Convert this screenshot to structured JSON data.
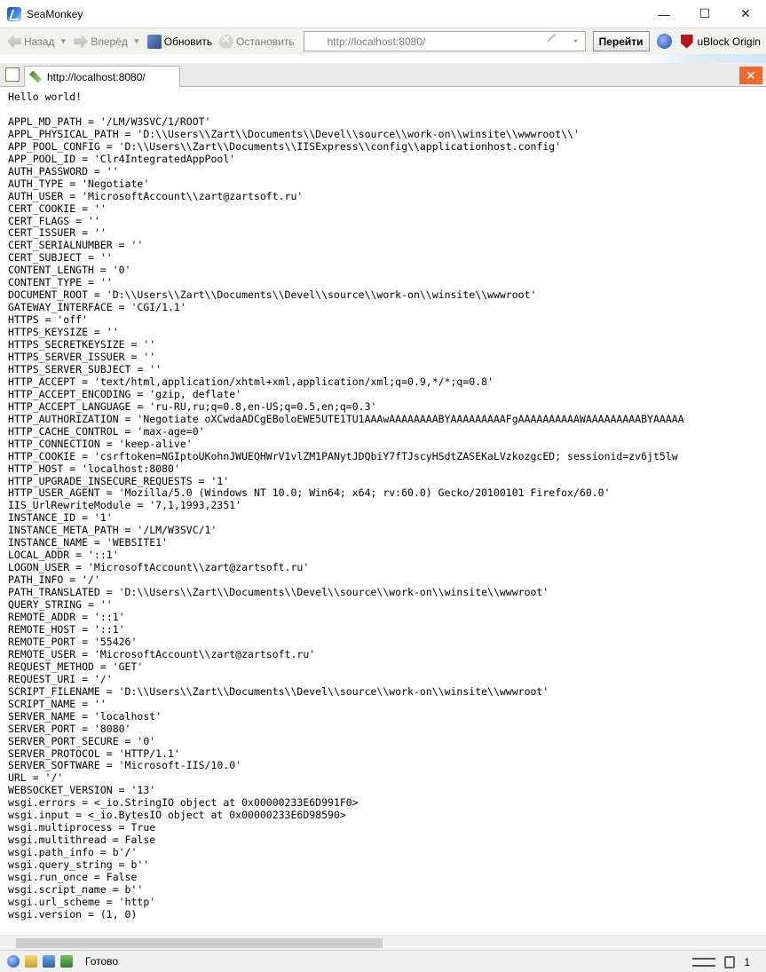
{
  "window": {
    "title": "SeaMonkey",
    "controls": {
      "minimize": "—",
      "maximize": "☐",
      "close": "✕"
    }
  },
  "toolbar": {
    "back_label": "Назад",
    "forward_label": "Вперёд",
    "reload_label": "Обновить",
    "stop_label": "Остановить",
    "url_value": "http://localhost:8080/",
    "go_label": "Перейти",
    "ublock_label": "uBlock Origin"
  },
  "tabs": [
    {
      "label": "http://localhost:8080/"
    }
  ],
  "page": {
    "greeting": "Hello world!",
    "lines": [
      "APPL_MD_PATH = '/LM/W3SVC/1/ROOT'",
      "APPL_PHYSICAL_PATH = 'D:\\\\Users\\\\Zart\\\\Documents\\\\Devel\\\\source\\\\work-on\\\\winsite\\\\wwwroot\\\\'",
      "APP_POOL_CONFIG = 'D:\\\\Users\\\\Zart\\\\Documents\\\\IISExpress\\\\config\\\\applicationhost.config'",
      "APP_POOL_ID = 'Clr4IntegratedAppPool'",
      "AUTH_PASSWORD = ''",
      "AUTH_TYPE = 'Negotiate'",
      "AUTH_USER = 'MicrosoftAccount\\\\zart@zartsoft.ru'",
      "CERT_COOKIE = ''",
      "CERT_FLAGS = ''",
      "CERT_ISSUER = ''",
      "CERT_SERIALNUMBER = ''",
      "CERT_SUBJECT = ''",
      "CONTENT_LENGTH = '0'",
      "CONTENT_TYPE = ''",
      "DOCUMENT_ROOT = 'D:\\\\Users\\\\Zart\\\\Documents\\\\Devel\\\\source\\\\work-on\\\\winsite\\\\wwwroot'",
      "GATEWAY_INTERFACE = 'CGI/1.1'",
      "HTTPS = 'off'",
      "HTTPS_KEYSIZE = ''",
      "HTTPS_SECRETKEYSIZE = ''",
      "HTTPS_SERVER_ISSUER = ''",
      "HTTPS_SERVER_SUBJECT = ''",
      "HTTP_ACCEPT = 'text/html,application/xhtml+xml,application/xml;q=0.9,*/*;q=0.8'",
      "HTTP_ACCEPT_ENCODING = 'gzip, deflate'",
      "HTTP_ACCEPT_LANGUAGE = 'ru-RU,ru;q=0.8,en-US;q=0.5,en;q=0.3'",
      "HTTP_AUTHORIZATION = 'Negotiate oXCwdaADCgEBoloEWE5UTE1TU1AAAwAAAAAAAABYAAAAAAAAAFgAAAAAAAAAAWAAAAAAAAABYAAAAA",
      "HTTP_CACHE_CONTROL = 'max-age=0'",
      "HTTP_CONNECTION = 'keep-alive'",
      "HTTP_COOKIE = 'csrftoken=NGIptoUKohnJWUEQHWrV1vlZM1PANytJDQbiY7fTJscyHSdtZASEKaLVzkozgcED; sessionid=zv6jt5lw",
      "HTTP_HOST = 'localhost:8080'",
      "HTTP_UPGRADE_INSECURE_REQUESTS = '1'",
      "HTTP_USER_AGENT = 'Mozilla/5.0 (Windows NT 10.0; Win64; x64; rv:60.0) Gecko/20100101 Firefox/60.0'",
      "IIS_UrlRewriteModule = '7,1,1993,2351'",
      "INSTANCE_ID = '1'",
      "INSTANCE_META_PATH = '/LM/W3SVC/1'",
      "INSTANCE_NAME = 'WEBSITE1'",
      "LOCAL_ADDR = '::1'",
      "LOGON_USER = 'MicrosoftAccount\\\\zart@zartsoft.ru'",
      "PATH_INFO = '/'",
      "PATH_TRANSLATED = 'D:\\\\Users\\\\Zart\\\\Documents\\\\Devel\\\\source\\\\work-on\\\\winsite\\\\wwwroot'",
      "QUERY_STRING = ''",
      "REMOTE_ADDR = '::1'",
      "REMOTE_HOST = '::1'",
      "REMOTE_PORT = '55426'",
      "REMOTE_USER = 'MicrosoftAccount\\\\zart@zartsoft.ru'",
      "REQUEST_METHOD = 'GET'",
      "REQUEST_URI = '/'",
      "SCRIPT_FILENAME = 'D:\\\\Users\\\\Zart\\\\Documents\\\\Devel\\\\source\\\\work-on\\\\winsite\\\\wwwroot'",
      "SCRIPT_NAME = ''",
      "SERVER_NAME = 'localhost'",
      "SERVER_PORT = '8080'",
      "SERVER_PORT_SECURE = '0'",
      "SERVER_PROTOCOL = 'HTTP/1.1'",
      "SERVER_SOFTWARE = 'Microsoft-IIS/10.0'",
      "URL = '/'",
      "WEBSOCKET_VERSION = '13'",
      "wsgi.errors = <_io.StringIO object at 0x00000233E6D991F0>",
      "wsgi.input = <_io.BytesIO object at 0x00000233E6D98590>",
      "wsgi.multiprocess = True",
      "wsgi.multithread = False",
      "wsgi.path_info = b'/'",
      "wsgi.query_string = b''",
      "wsgi.run_once = False",
      "wsgi.script_name = b''",
      "wsgi.url_scheme = 'http'",
      "wsgi.version = (1, 0)"
    ]
  },
  "statusbar": {
    "status_text": "Готово",
    "count": "1"
  },
  "colors": {
    "close_tab_accent": "#ea6a2f",
    "ublock_red": "#b3141f"
  }
}
